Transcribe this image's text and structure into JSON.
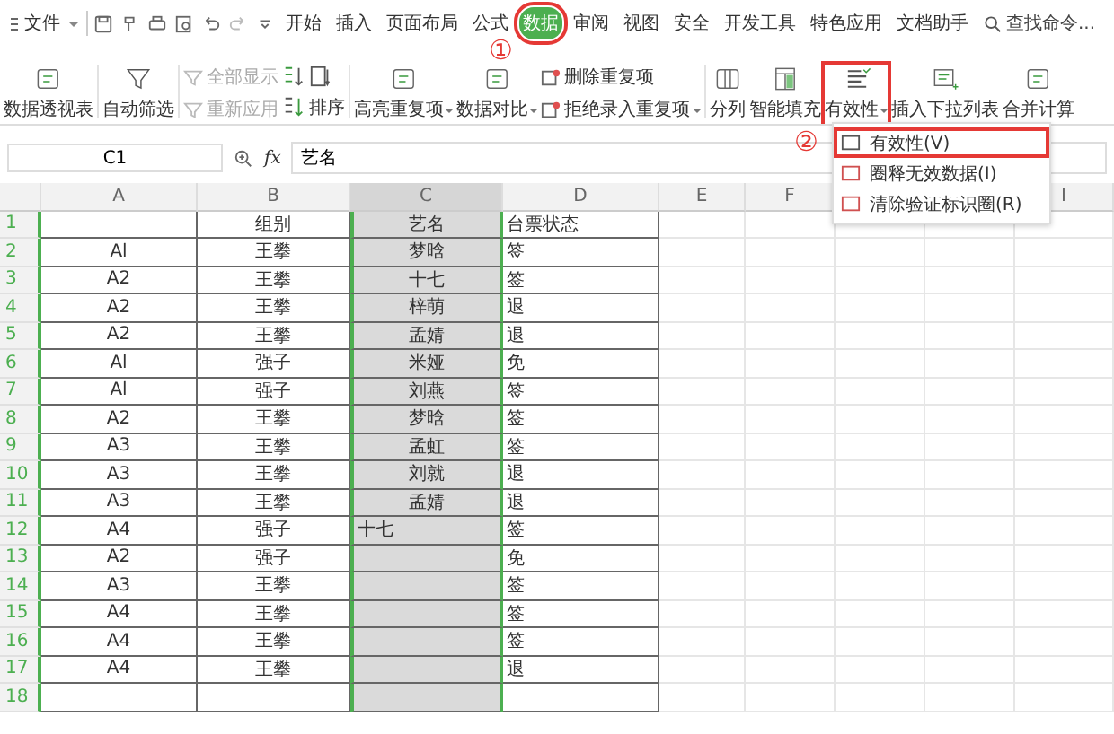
{
  "menu": {
    "file": "文件",
    "tabs": [
      {
        "label": "开始",
        "selected": false
      },
      {
        "label": "插入",
        "selected": false
      },
      {
        "label": "页面布局",
        "selected": false
      },
      {
        "label": "公式",
        "selected": false
      },
      {
        "label": "数据",
        "selected": true,
        "highlighted": true
      },
      {
        "label": "审阅",
        "selected": false
      },
      {
        "label": "视图",
        "selected": false
      },
      {
        "label": "安全",
        "selected": false
      },
      {
        "label": "开发工具",
        "selected": false
      },
      {
        "label": "特色应用",
        "selected": false
      },
      {
        "label": "文档助手",
        "selected": false
      }
    ],
    "search": {
      "placeholder": "查找命令..."
    }
  },
  "ribbon": [
    {
      "kind": "large",
      "label": "数据透视表",
      "dropdown": false,
      "highlighted": false
    },
    {
      "kind": "large",
      "label": "自动筛选",
      "dropdown": false,
      "highlighted": false
    },
    {
      "kind": "stack",
      "items": [
        {
          "label": "全部显示",
          "disabled": true,
          "dropdown": false
        },
        {
          "label": "重新应用",
          "disabled": true,
          "dropdown": false
        }
      ]
    },
    {
      "kind": "sort",
      "label": "排序"
    },
    {
      "kind": "large",
      "label": "高亮重复项",
      "dropdown": true,
      "highlighted": false
    },
    {
      "kind": "large",
      "label": "数据对比",
      "dropdown": true,
      "highlighted": false
    },
    {
      "kind": "stack",
      "items": [
        {
          "label": "删除重复项",
          "disabled": false,
          "dropdown": false
        },
        {
          "label": "拒绝录入重复项",
          "disabled": false,
          "dropdown": true
        }
      ]
    },
    {
      "kind": "large",
      "label": "分列",
      "dropdown": false,
      "highlighted": false
    },
    {
      "kind": "large",
      "label": "智能填充",
      "dropdown": false,
      "highlighted": false
    },
    {
      "kind": "large",
      "label": "有效性",
      "dropdown": true,
      "highlighted": true
    },
    {
      "kind": "large",
      "label": "插入下拉列表",
      "dropdown": false,
      "highlighted": false
    },
    {
      "kind": "large",
      "label": "合并计算",
      "dropdown": false,
      "highlighted": false
    }
  ],
  "dropdown_menu": [
    {
      "label": "有效性(V)",
      "highlighted": true
    },
    {
      "label": "圈释无效数据(I)",
      "highlighted": false
    },
    {
      "label": "清除验证标识圈(R)",
      "highlighted": false
    }
  ],
  "annotations": [
    "①",
    "②"
  ],
  "formula_bar": {
    "cell": "C1",
    "fx": "fx",
    "value": "艺名"
  },
  "sheet": {
    "columns": [
      {
        "label": "A",
        "selected": false
      },
      {
        "label": "B",
        "selected": false
      },
      {
        "label": "C",
        "selected": true
      },
      {
        "label": "D",
        "selected": false
      },
      {
        "label": "E",
        "selected": false
      },
      {
        "label": "F",
        "selected": false
      },
      {
        "label": "I",
        "selected": false
      }
    ],
    "rows": [
      {
        "n": "1",
        "cells": [
          "",
          "组别",
          "艺名",
          "台票状态"
        ]
      },
      {
        "n": "2",
        "cells": [
          "Al",
          "王攀",
          "梦晗",
          "签"
        ]
      },
      {
        "n": "3",
        "cells": [
          "A2",
          "王攀",
          "十七",
          "签"
        ]
      },
      {
        "n": "4",
        "cells": [
          "A2",
          "王攀",
          "梓萌",
          "退"
        ]
      },
      {
        "n": "5",
        "cells": [
          "A2",
          "王攀",
          "孟婧",
          "退"
        ]
      },
      {
        "n": "6",
        "cells": [
          "Al",
          "强子",
          "米娅",
          "免"
        ]
      },
      {
        "n": "7",
        "cells": [
          "Al",
          "强子",
          "刘燕",
          "签"
        ]
      },
      {
        "n": "8",
        "cells": [
          "A2",
          "王攀",
          "梦晗",
          "签"
        ]
      },
      {
        "n": "9",
        "cells": [
          "A3",
          "王攀",
          "孟虹",
          "签"
        ]
      },
      {
        "n": "10",
        "cells": [
          "A3",
          "王攀",
          "刘就",
          "退"
        ]
      },
      {
        "n": "11",
        "cells": [
          "A3",
          "王攀",
          "孟婧",
          "退"
        ]
      },
      {
        "n": "12",
        "cells": [
          "A4",
          "强子",
          "十七",
          "签"
        ],
        "editing": true
      },
      {
        "n": "13",
        "cells": [
          "A2",
          "强子",
          "",
          "免"
        ]
      },
      {
        "n": "14",
        "cells": [
          "A3",
          "王攀",
          "",
          "签"
        ]
      },
      {
        "n": "15",
        "cells": [
          "A4",
          "王攀",
          "",
          "签"
        ]
      },
      {
        "n": "16",
        "cells": [
          "A4",
          "王攀",
          "",
          "签"
        ]
      },
      {
        "n": "17",
        "cells": [
          "A4",
          "王攀",
          "",
          "退"
        ]
      },
      {
        "n": "18",
        "cells": [
          "",
          "",
          "",
          ""
        ]
      }
    ]
  }
}
